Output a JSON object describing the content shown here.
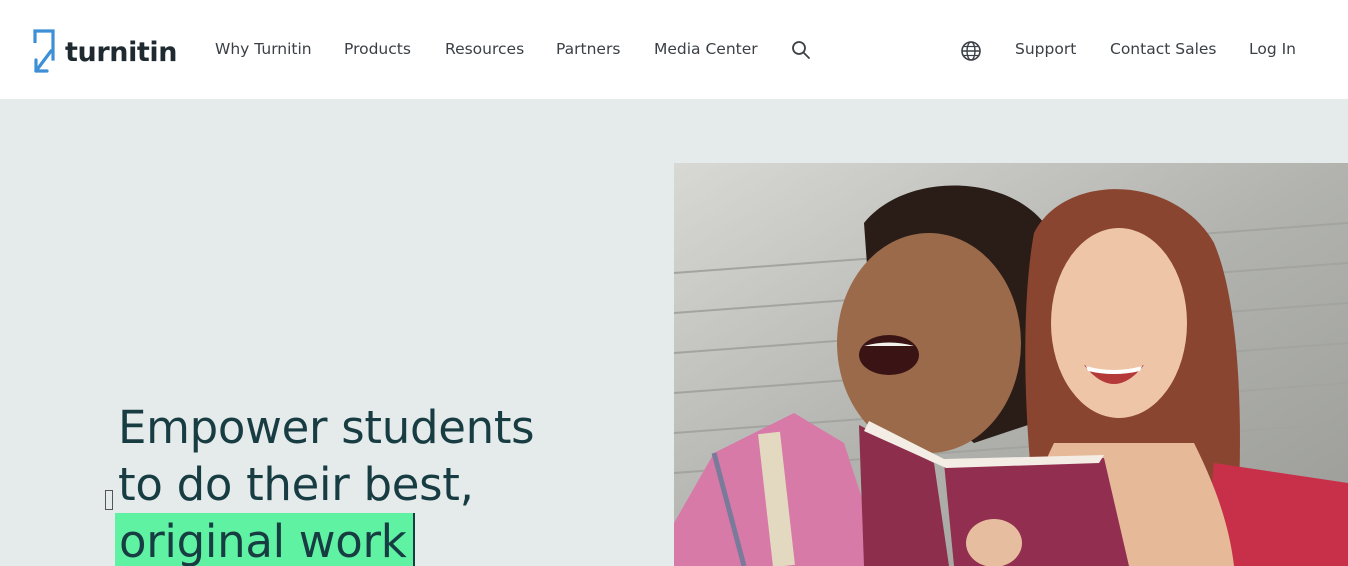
{
  "brand": {
    "name": "turnitin",
    "color": "#3d8fd6"
  },
  "nav": {
    "links": [
      "Why Turnitin",
      "Products",
      "Resources",
      "Partners",
      "Media Center"
    ],
    "right_links": [
      "Support",
      "Contact Sales",
      "Log In"
    ],
    "icons": {
      "search": "search-icon",
      "language": "globe-icon"
    }
  },
  "hero": {
    "headline_line1": "Empower students",
    "headline_line2": "to do their best,",
    "headline_highlight": "original work",
    "highlight_color": "#5ff2a2",
    "text_color": "#173d43",
    "background": "#e5eaea"
  }
}
